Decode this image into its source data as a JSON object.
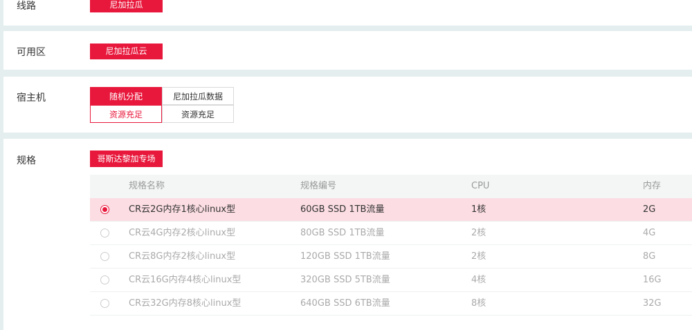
{
  "line": {
    "label": "线路",
    "value": "尼加拉瓜"
  },
  "zone": {
    "label": "可用区",
    "value": "尼加拉瓜云"
  },
  "host": {
    "label": "宿主机",
    "options": [
      {
        "name": "随机分配",
        "status": "资源充足"
      },
      {
        "name": "尼加拉瓜数据",
        "status": "资源充足"
      }
    ]
  },
  "spec": {
    "label": "规格",
    "tag": "哥斯达黎加专场",
    "headers": [
      "规格名称",
      "规格编号",
      "CPU",
      "内存"
    ],
    "rows": [
      {
        "name": "CR云2G内存1核心linux型",
        "code": "60GB SSD 1TB流量",
        "cpu": "1核",
        "mem": "2G",
        "selected": true
      },
      {
        "name": "CR云4G内存2核心linux型",
        "code": "80GB SSD 1TB流量",
        "cpu": "2核",
        "mem": "4G",
        "selected": false
      },
      {
        "name": "CR云8G内存2核心linux型",
        "code": "120GB SSD 1TB流量",
        "cpu": "2核",
        "mem": "8G",
        "selected": false
      },
      {
        "name": "CR云16G内存4核心linux型",
        "code": "320GB SSD 5TB流量",
        "cpu": "4核",
        "mem": "16G",
        "selected": false
      },
      {
        "name": "CR云32G内存8核心linux型",
        "code": "640GB SSD 6TB流量",
        "cpu": "8核",
        "mem": "32G",
        "selected": false
      }
    ]
  },
  "colors": {
    "accent": "#e8183c",
    "selected_row": "#fbdde3",
    "background": "#e4eeee"
  }
}
